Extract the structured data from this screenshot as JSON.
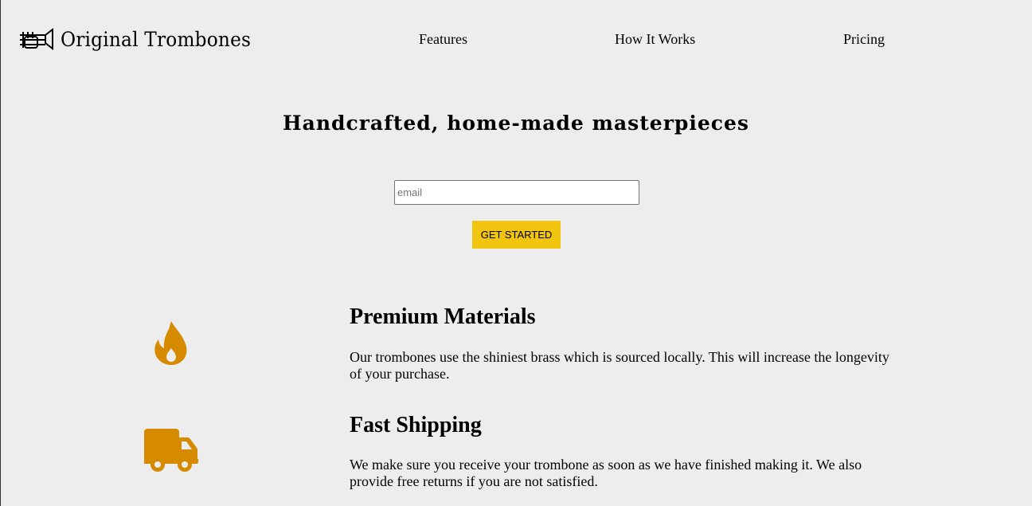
{
  "header": {
    "logo_icon": "trombone-icon",
    "brand": "Original Trombones",
    "nav": [
      {
        "label": "Features"
      },
      {
        "label": "How It Works"
      },
      {
        "label": "Pricing"
      }
    ]
  },
  "hero": {
    "title": "Handcrafted, home-made masterpieces",
    "email_placeholder": "email",
    "email_value": "",
    "cta_label": "GET STARTED"
  },
  "features": [
    {
      "icon": "fire-icon",
      "heading": "Premium Materials",
      "description": "Our trombones use the shiniest brass which is sourced locally. This will increase the longevity of your purchase."
    },
    {
      "icon": "truck-icon",
      "heading": "Fast Shipping",
      "description": "We make sure you receive your trombone as soon as we have finished making it. We also provide free returns if you are not satisfied."
    }
  ],
  "colors": {
    "background": "#eeeded",
    "accent": "#f1c40f",
    "icon": "#d58a00"
  }
}
